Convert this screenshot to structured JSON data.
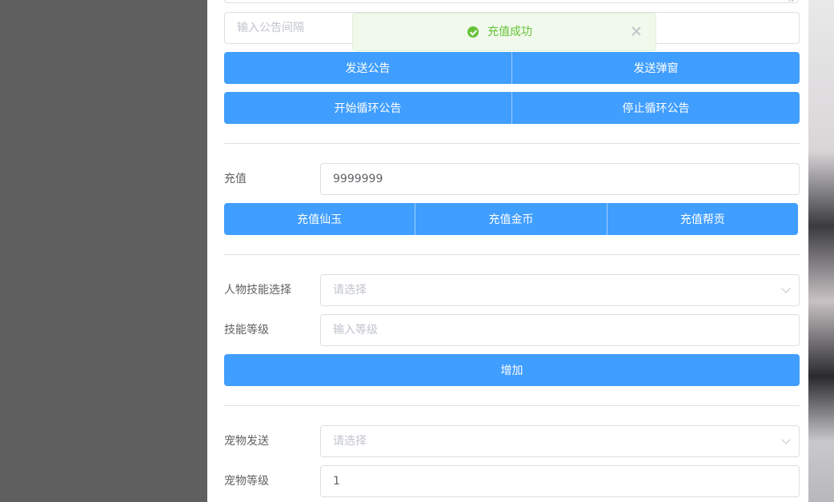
{
  "announcement": {
    "interval_placeholder": "输入公告间隔",
    "send_announcement": "发送公告",
    "send_popup": "发送弹窗",
    "start_loop": "开始循环公告",
    "stop_loop": "停止循环公告"
  },
  "recharge": {
    "label": "充值",
    "amount_value": "9999999",
    "recharge_jade": "充值仙玉",
    "recharge_gold": "充值金币",
    "recharge_guild": "充值帮贡"
  },
  "skill": {
    "select_label": "人物技能选择",
    "select_placeholder": "请选择",
    "level_label": "技能等级",
    "level_placeholder": "输入等级",
    "add_button": "增加"
  },
  "pet": {
    "send_label": "宠物发送",
    "send_placeholder": "请选择",
    "level_label": "宠物等级",
    "level_value": "1"
  },
  "toast": {
    "message": "充值成功",
    "icon": "success-check-icon",
    "color": "#67c23a"
  },
  "colors": {
    "primary": "#409eff",
    "success": "#67c23a",
    "border": "#dcdfe6"
  }
}
